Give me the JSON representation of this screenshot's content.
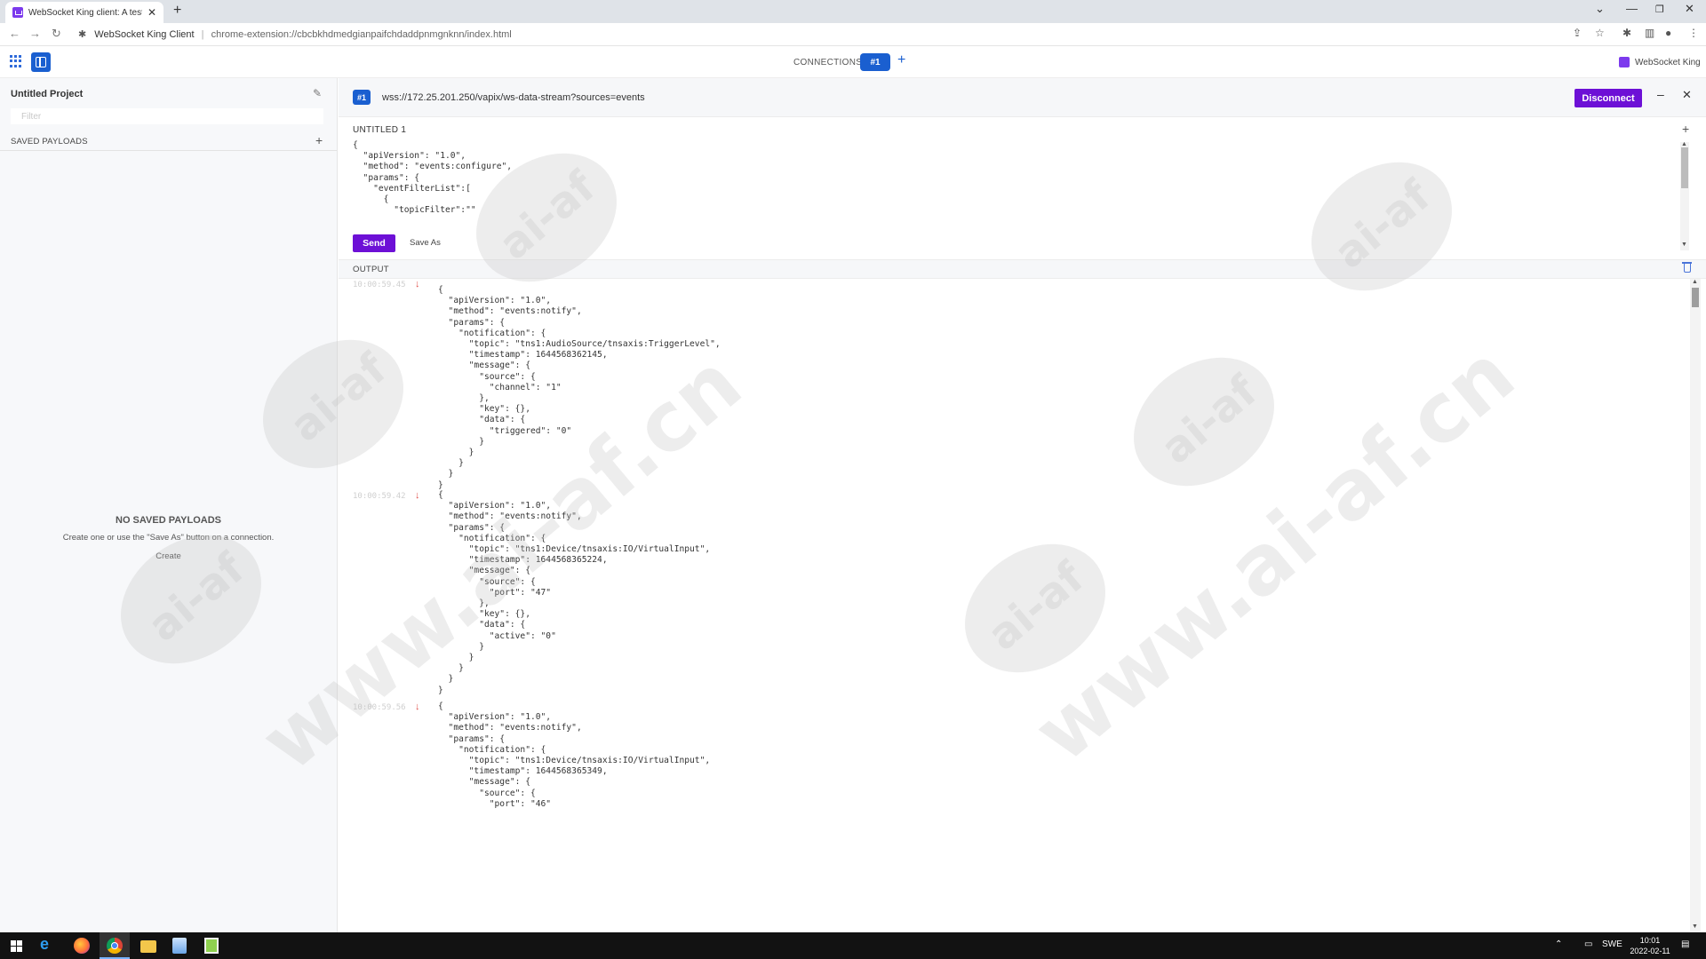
{
  "browser": {
    "tab_title": "WebSocket King client: A testing",
    "tab_close": "✕",
    "new_tab": "+",
    "address_site": "WebSocket King Client",
    "address_sep": "|",
    "address_path": "chrome-extension://cbcbkhdmedgianpaifchdaddpnmgnknn/index.html"
  },
  "app_bar": {
    "connections_label": "CONNECTIONS",
    "active_connection": "#1",
    "add_connection": "+",
    "brand_name": "WebSocket King"
  },
  "sidebar": {
    "project_title": "Untitled Project",
    "filter_placeholder": "Filter",
    "saved_payloads_label": "SAVED PAYLOADS",
    "saved_add": "+",
    "empty_title": "NO SAVED PAYLOADS",
    "empty_desc": "Create one or use the \"Save As\" button on a connection.",
    "create_link": "Create"
  },
  "connection": {
    "id_badge": "#1",
    "url": "wss://172.25.201.250/vapix/ws-data-stream?sources=events",
    "disconnect_label": "Disconnect",
    "minimize": "–",
    "close": "✕",
    "payload_title": "UNTITLED 1",
    "payload_add": "+",
    "payload_text": "{\n  \"apiVersion\": \"1.0\",\n  \"method\": \"events:configure\",\n  \"params\": {\n    \"eventFilterList\":[\n      {\n        \"topicFilter\":\"\"",
    "send_label": "Send",
    "save_as_label": "Save As"
  },
  "output": {
    "label": "OUTPUT",
    "messages": [
      {
        "time": "10:00:59.45",
        "direction": "↓",
        "body": "{\n  \"apiVersion\": \"1.0\",\n  \"method\": \"events:notify\",\n  \"params\": {\n    \"notification\": {\n      \"topic\": \"tns1:AudioSource/tnsaxis:TriggerLevel\",\n      \"timestamp\": 1644568362145,\n      \"message\": {\n        \"source\": {\n          \"channel\": \"1\"\n        },\n        \"key\": {},\n        \"data\": {\n          \"triggered\": \"0\"\n        }\n      }\n    }\n  }\n}"
      },
      {
        "time": "10:00:59.42",
        "direction": "↓",
        "body": "{\n  \"apiVersion\": \"1.0\",\n  \"method\": \"events:notify\",\n  \"params\": {\n    \"notification\": {\n      \"topic\": \"tns1:Device/tnsaxis:IO/VirtualInput\",\n      \"timestamp\": 1644568365224,\n      \"message\": {\n        \"source\": {\n          \"port\": \"47\"\n        },\n        \"key\": {},\n        \"data\": {\n          \"active\": \"0\"\n        }\n      }\n    }\n  }\n}"
      },
      {
        "time": "10:00:59.56",
        "direction": "↓",
        "body": "{\n  \"apiVersion\": \"1.0\",\n  \"method\": \"events:notify\",\n  \"params\": {\n    \"notification\": {\n      \"topic\": \"tns1:Device/tnsaxis:IO/VirtualInput\",\n      \"timestamp\": 1644568365349,\n      \"message\": {\n        \"source\": {\n          \"port\": \"46\""
      }
    ]
  },
  "taskbar": {
    "tray_lang": "SWE",
    "clock_time": "10:01",
    "clock_date": "2022-02-11"
  },
  "watermark": {
    "url_text": "www.ai-af.cn",
    "oval_text": "ai-af"
  },
  "colors": {
    "accent_purple": "#6d10d6",
    "accent_blue": "#1a5fd0",
    "incoming_arrow": "#e0524d"
  }
}
